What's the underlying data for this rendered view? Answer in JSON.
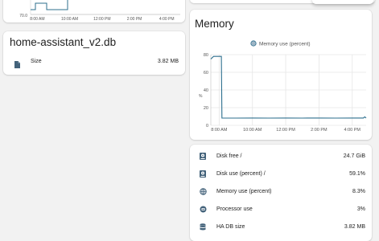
{
  "colors": {
    "accent": "#2d6f8e",
    "icon": "#43627a",
    "grid": "#e6e6e6",
    "chart_bg": "#ffffff"
  },
  "top_chart": {
    "y_tick": "70.0",
    "x_ticks": [
      "8:00 AM",
      "10:00 AM",
      "12:00 PM",
      "2:00 PM",
      "4:00 PM"
    ]
  },
  "db_card": {
    "title": "home-assistant_v2.db",
    "rows": [
      {
        "icon": "file-icon",
        "label": "Size",
        "value": "3.82 MB"
      }
    ]
  },
  "memory_card": {
    "title": "Memory",
    "legend": "Memory use (percent)",
    "ylabel": "%"
  },
  "chart_data": {
    "type": "line",
    "title": "",
    "series": [
      {
        "name": "Memory use (percent)",
        "x": [
          "7:30 AM",
          "7:40 AM",
          "7:55 AM",
          "8:05 AM",
          "8:08 AM",
          "8:10 AM",
          "9:00 AM",
          "10:00 AM",
          "11:00 AM",
          "12:00 PM",
          "1:00 PM",
          "2:00 PM",
          "3:00 PM",
          "4:00 PM",
          "4:40 PM",
          "4:45 PM",
          "4:50 PM"
        ],
        "values": [
          75,
          78,
          78,
          78,
          78,
          8.3,
          8.2,
          8.3,
          8.2,
          8.3,
          8.2,
          8.3,
          8.2,
          8.3,
          8.3,
          9.5,
          8.3
        ]
      }
    ],
    "y_ticks": [
      0,
      20,
      40,
      60,
      80
    ],
    "x_ticks": [
      "8:00 AM",
      "10:00 AM",
      "12:00 PM",
      "2:00 PM",
      "4:00 PM"
    ],
    "ylim": [
      0,
      80
    ],
    "ylabel": "%",
    "grid": true,
    "legend": "top-center"
  },
  "system_card": {
    "rows": [
      {
        "icon": "harddisk-icon",
        "label": "Disk free /",
        "value": "24.7 GiB"
      },
      {
        "icon": "harddisk-icon",
        "label": "Disk use (percent) /",
        "value": "59.1%"
      },
      {
        "icon": "memory-icon",
        "label": "Memory use (percent)",
        "value": "8.3%"
      },
      {
        "icon": "cpu-icon",
        "label": "Processor use",
        "value": "3%"
      },
      {
        "icon": "database-icon",
        "label": "HA DB size",
        "value": "3.82 MB"
      }
    ]
  }
}
